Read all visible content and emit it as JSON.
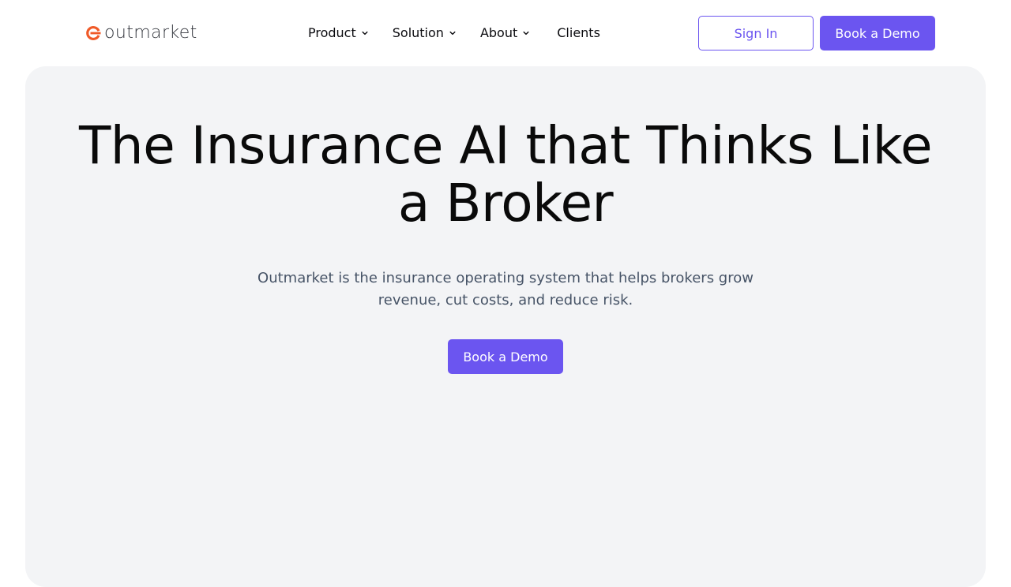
{
  "brand": {
    "name": "outmarket",
    "logo_icon": "outmarket-logo-mark",
    "logo_color": "#f05a28"
  },
  "nav": {
    "items": [
      {
        "label": "Product",
        "has_dropdown": true,
        "icon": "chevron-down-icon"
      },
      {
        "label": "Solution",
        "has_dropdown": true,
        "icon": "chevron-down-icon"
      },
      {
        "label": "About",
        "has_dropdown": true,
        "icon": "chevron-down-icon"
      },
      {
        "label": "Clients",
        "has_dropdown": false
      }
    ],
    "sign_in_label": "Sign In",
    "book_demo_label": "Book a Demo"
  },
  "hero": {
    "title": "The Insurance AI that Thinks Like a Broker",
    "subtitle": "Outmarket is the insurance operating system that helps brokers grow revenue, cut costs, and reduce risk.",
    "cta_label": "Book a Demo"
  },
  "colors": {
    "accent": "#6b55f0",
    "brand_orange": "#f05a28",
    "hero_background": "#f3f4f6",
    "subtitle_text": "#475467"
  }
}
